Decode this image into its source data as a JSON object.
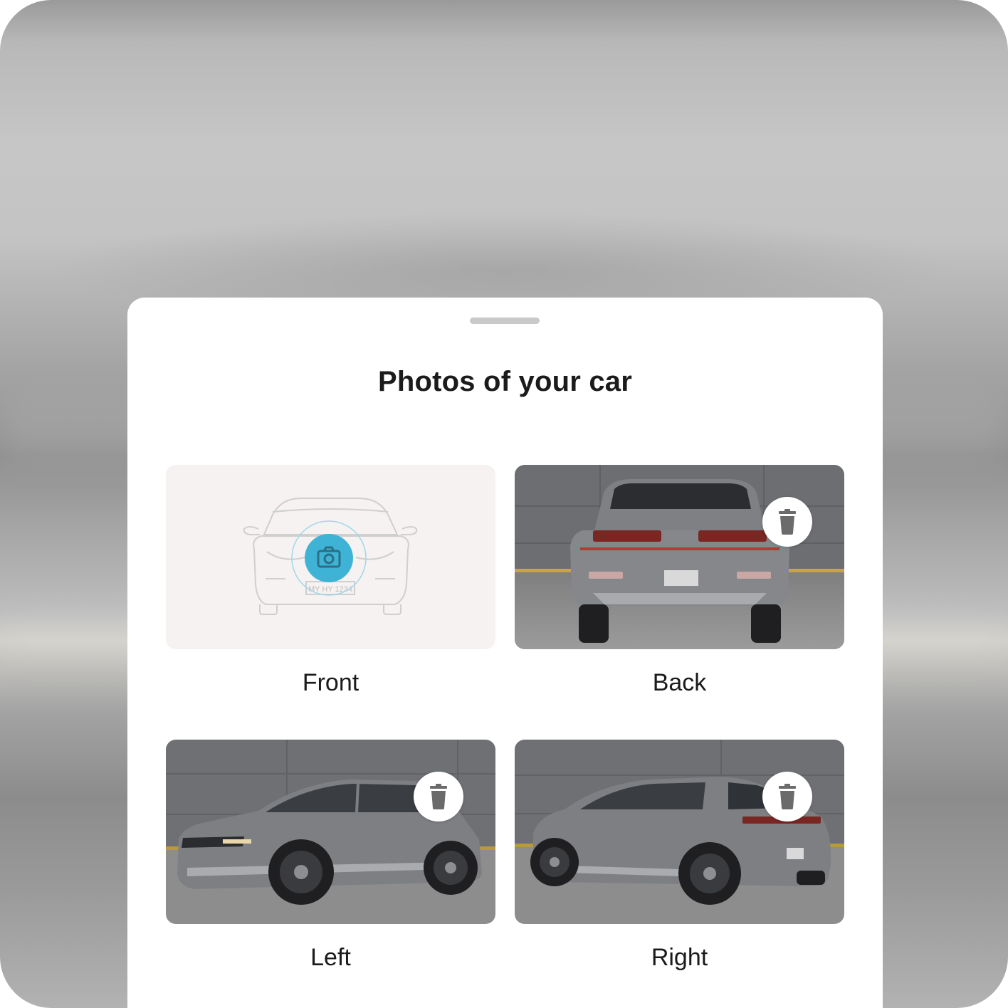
{
  "sheet": {
    "title": "Photos of your car"
  },
  "photos": [
    {
      "label": "Front",
      "status": "empty",
      "plate_text": "MY HY 1234",
      "action_icon": "camera-icon"
    },
    {
      "label": "Back",
      "status": "uploaded",
      "action_icon": "trash-icon"
    },
    {
      "label": "Left",
      "status": "uploaded",
      "action_icon": "trash-icon"
    },
    {
      "label": "Right",
      "status": "uploaded",
      "action_icon": "trash-icon"
    }
  ],
  "colors": {
    "accent": "#3fb3d6",
    "title_text": "#1b1b1b",
    "placeholder_bg": "#f5f2f1",
    "car_body": "#7f8185"
  }
}
